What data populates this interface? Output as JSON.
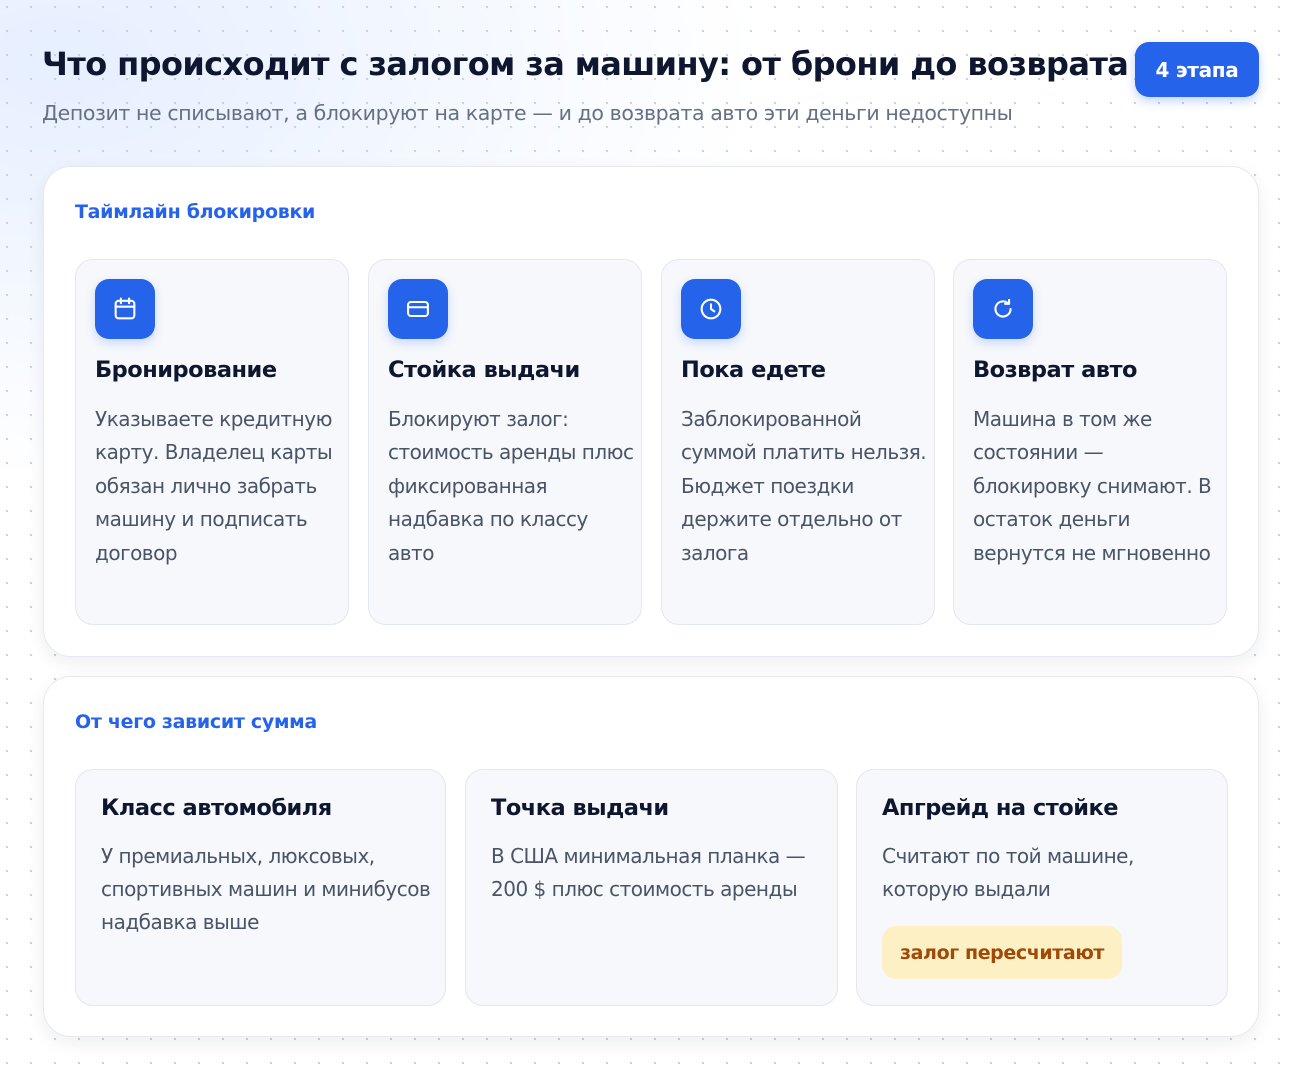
{
  "header": {
    "title": "Что происходит с залогом за машину: от брони до возврата",
    "subtitle": "Депозит не списывают, а блокируют на карте — и до возврата авто эти деньги недоступны",
    "badge": "4 этапа"
  },
  "timeline": {
    "title": "Таймлайн блокировки",
    "steps": [
      {
        "icon": "calendar-icon",
        "title": "Бронирование",
        "text": "Указываете кредитную карту. Владелец карты обязан лично забрать машину и подписать договор"
      },
      {
        "icon": "credit-card-icon",
        "title": "Стойка выдачи",
        "text": "Блокируют залог: стоимость аренды плюс фиксированная надбавка по классу авто"
      },
      {
        "icon": "clock-icon",
        "title": "Пока едете",
        "text": "Заблокированной суммой платить нельзя. Бюджет поездки держите отдельно от залога"
      },
      {
        "icon": "refresh-icon",
        "title": "Возврат авто",
        "text": "Машина в том же состоянии — блокировку снимают. В остаток деньги вернутся не мгновенно"
      }
    ]
  },
  "factors": {
    "title": "От чего зависит сумма",
    "items": [
      {
        "title": "Класс автомобиля",
        "text": "У премиальных, люксовых, спортивных машин и минибусов надбавка выше"
      },
      {
        "title": "Точка выдачи",
        "text": "В США минимальная планка — 200 $ плюс стоимость аренды"
      },
      {
        "title": "Апгрейд на стойке",
        "text": "Считают по той машине, которую выдали",
        "note": "залог пересчитают"
      }
    ]
  },
  "colors": {
    "accent": "#2563eb",
    "note_bg": "#fdf0c4",
    "note_text": "#a04a07"
  }
}
